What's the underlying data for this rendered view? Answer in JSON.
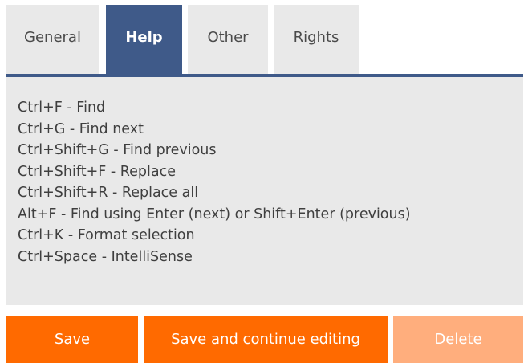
{
  "tabs": [
    {
      "label": "General",
      "active": false
    },
    {
      "label": "Help",
      "active": true
    },
    {
      "label": "Other",
      "active": false
    },
    {
      "label": "Rights",
      "active": false
    }
  ],
  "help": {
    "shortcuts": [
      "Ctrl+F - Find",
      "Ctrl+G - Find next",
      "Ctrl+Shift+G - Find previous",
      "Ctrl+Shift+F - Replace",
      "Ctrl+Shift+R - Replace all",
      "Alt+F - Find using Enter (next) or Shift+Enter (previous)",
      "Ctrl+K - Format selection",
      "Ctrl+Space - IntelliSense"
    ]
  },
  "actions": {
    "save_label": "Save",
    "save_continue_label": "Save and continue editing",
    "delete_label": "Delete"
  },
  "colors": {
    "accent": "#3f5a89",
    "primary_button": "#ff6a00",
    "disabled_button": "#ffae7d",
    "tab_background": "#e9e9e9"
  }
}
